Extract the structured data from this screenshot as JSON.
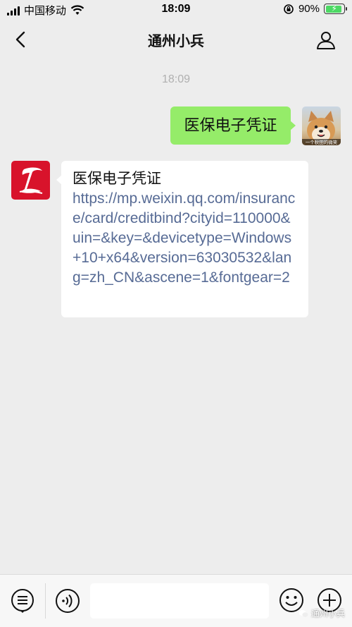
{
  "status_bar": {
    "carrier": "中国移动",
    "time": "18:09",
    "battery_percent": "90%",
    "battery_level": 0.9,
    "accent_green": "#4cd964"
  },
  "nav": {
    "title": "通州小兵",
    "back_icon": "chevron-left-icon",
    "profile_icon": "person-icon"
  },
  "chat": {
    "timestamp": "18:09",
    "outgoing": {
      "text": "医保电子凭证",
      "bubble_color": "#95ec69"
    },
    "incoming": {
      "title": "医保电子凭证",
      "link": "https://mp.weixin.qq.com/insurance/card/creditbind?cityid=110000&uin=&key=&devicetype=Windows+10+x64&version=63030532&lang=zh_CN&ascene=1&fontgear=2",
      "link_color": "#576b95"
    },
    "avatar_right_caption": "一个秋田的微笑"
  },
  "bottom_bar": {
    "menu_icon": "list-menu-icon",
    "voice_icon": "voice-icon",
    "emoji_icon": "emoji-icon",
    "plus_icon": "plus-circle-icon",
    "watermark": "通州小兵"
  }
}
